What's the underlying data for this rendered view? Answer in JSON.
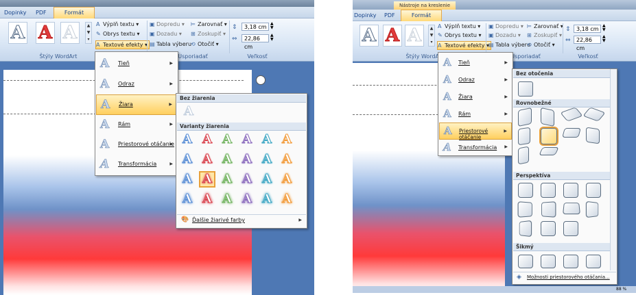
{
  "left": {
    "tabs": [
      "Dopinky",
      "PDF",
      "Formát"
    ],
    "ribbon": {
      "fill_text": "Výplň textu",
      "outline_text": "Obrys textu",
      "text_effects": "Textové efekty",
      "forward": "Dopredu",
      "backward": "Dozadu",
      "selection_pane": "Tabla výberu",
      "align": "Zarovnať",
      "group": "Zoskupiť",
      "rotate": "Otočiť",
      "height": "3,18 cm",
      "width": "22,86 cm",
      "group_wordart": "Štýly WordArt",
      "group_arrange": "Usporiadať",
      "group_size": "Veľkosť"
    },
    "menu": [
      "Tieň",
      "Odraz",
      "Žiara",
      "Rám",
      "Priestorové otáčanie",
      "Transformácia"
    ],
    "glow_gallery": {
      "no_glow": "Bez žiarenia",
      "variants": "Varianty žiarenia",
      "more_colors": "Ďalšie žiarivé farby",
      "row_colors": [
        "#5b8fd6",
        "#d9434e",
        "#71b35f",
        "#8b6bbd",
        "#3fa7c4",
        "#f29a38"
      ]
    }
  },
  "right": {
    "title": "Nástroje na kreslenie",
    "tabs": [
      "Dopinky",
      "PDF",
      "Formát"
    ],
    "ribbon": {
      "fill_text": "Výplň textu",
      "outline_text": "Obrys textu",
      "text_effects": "Textové efekty",
      "forward": "Dopredu",
      "backward": "Dozadu",
      "selection_pane": "Tabla výberu",
      "align": "Zarovnať",
      "group": "Zoskupiť",
      "rotate": "Otočiť",
      "height": "3,18 cm",
      "width": "22,86 cm",
      "group_wordart": "Štýly WordArt",
      "group_arrange": "Usporiadať",
      "group_size": "Veľkosť"
    },
    "menu": [
      "Tieň",
      "Odraz",
      "Žiara",
      "Rám",
      "Priestorové otáčanie",
      "Transformácia"
    ],
    "rotation_gallery": {
      "none": "Bez otočenia",
      "parallel": "Rovnobežné",
      "perspective": "Perspektíva",
      "oblique": "Šikmý",
      "options": "Možnosti priestorového otáčania..."
    },
    "zoom": "88 %"
  }
}
